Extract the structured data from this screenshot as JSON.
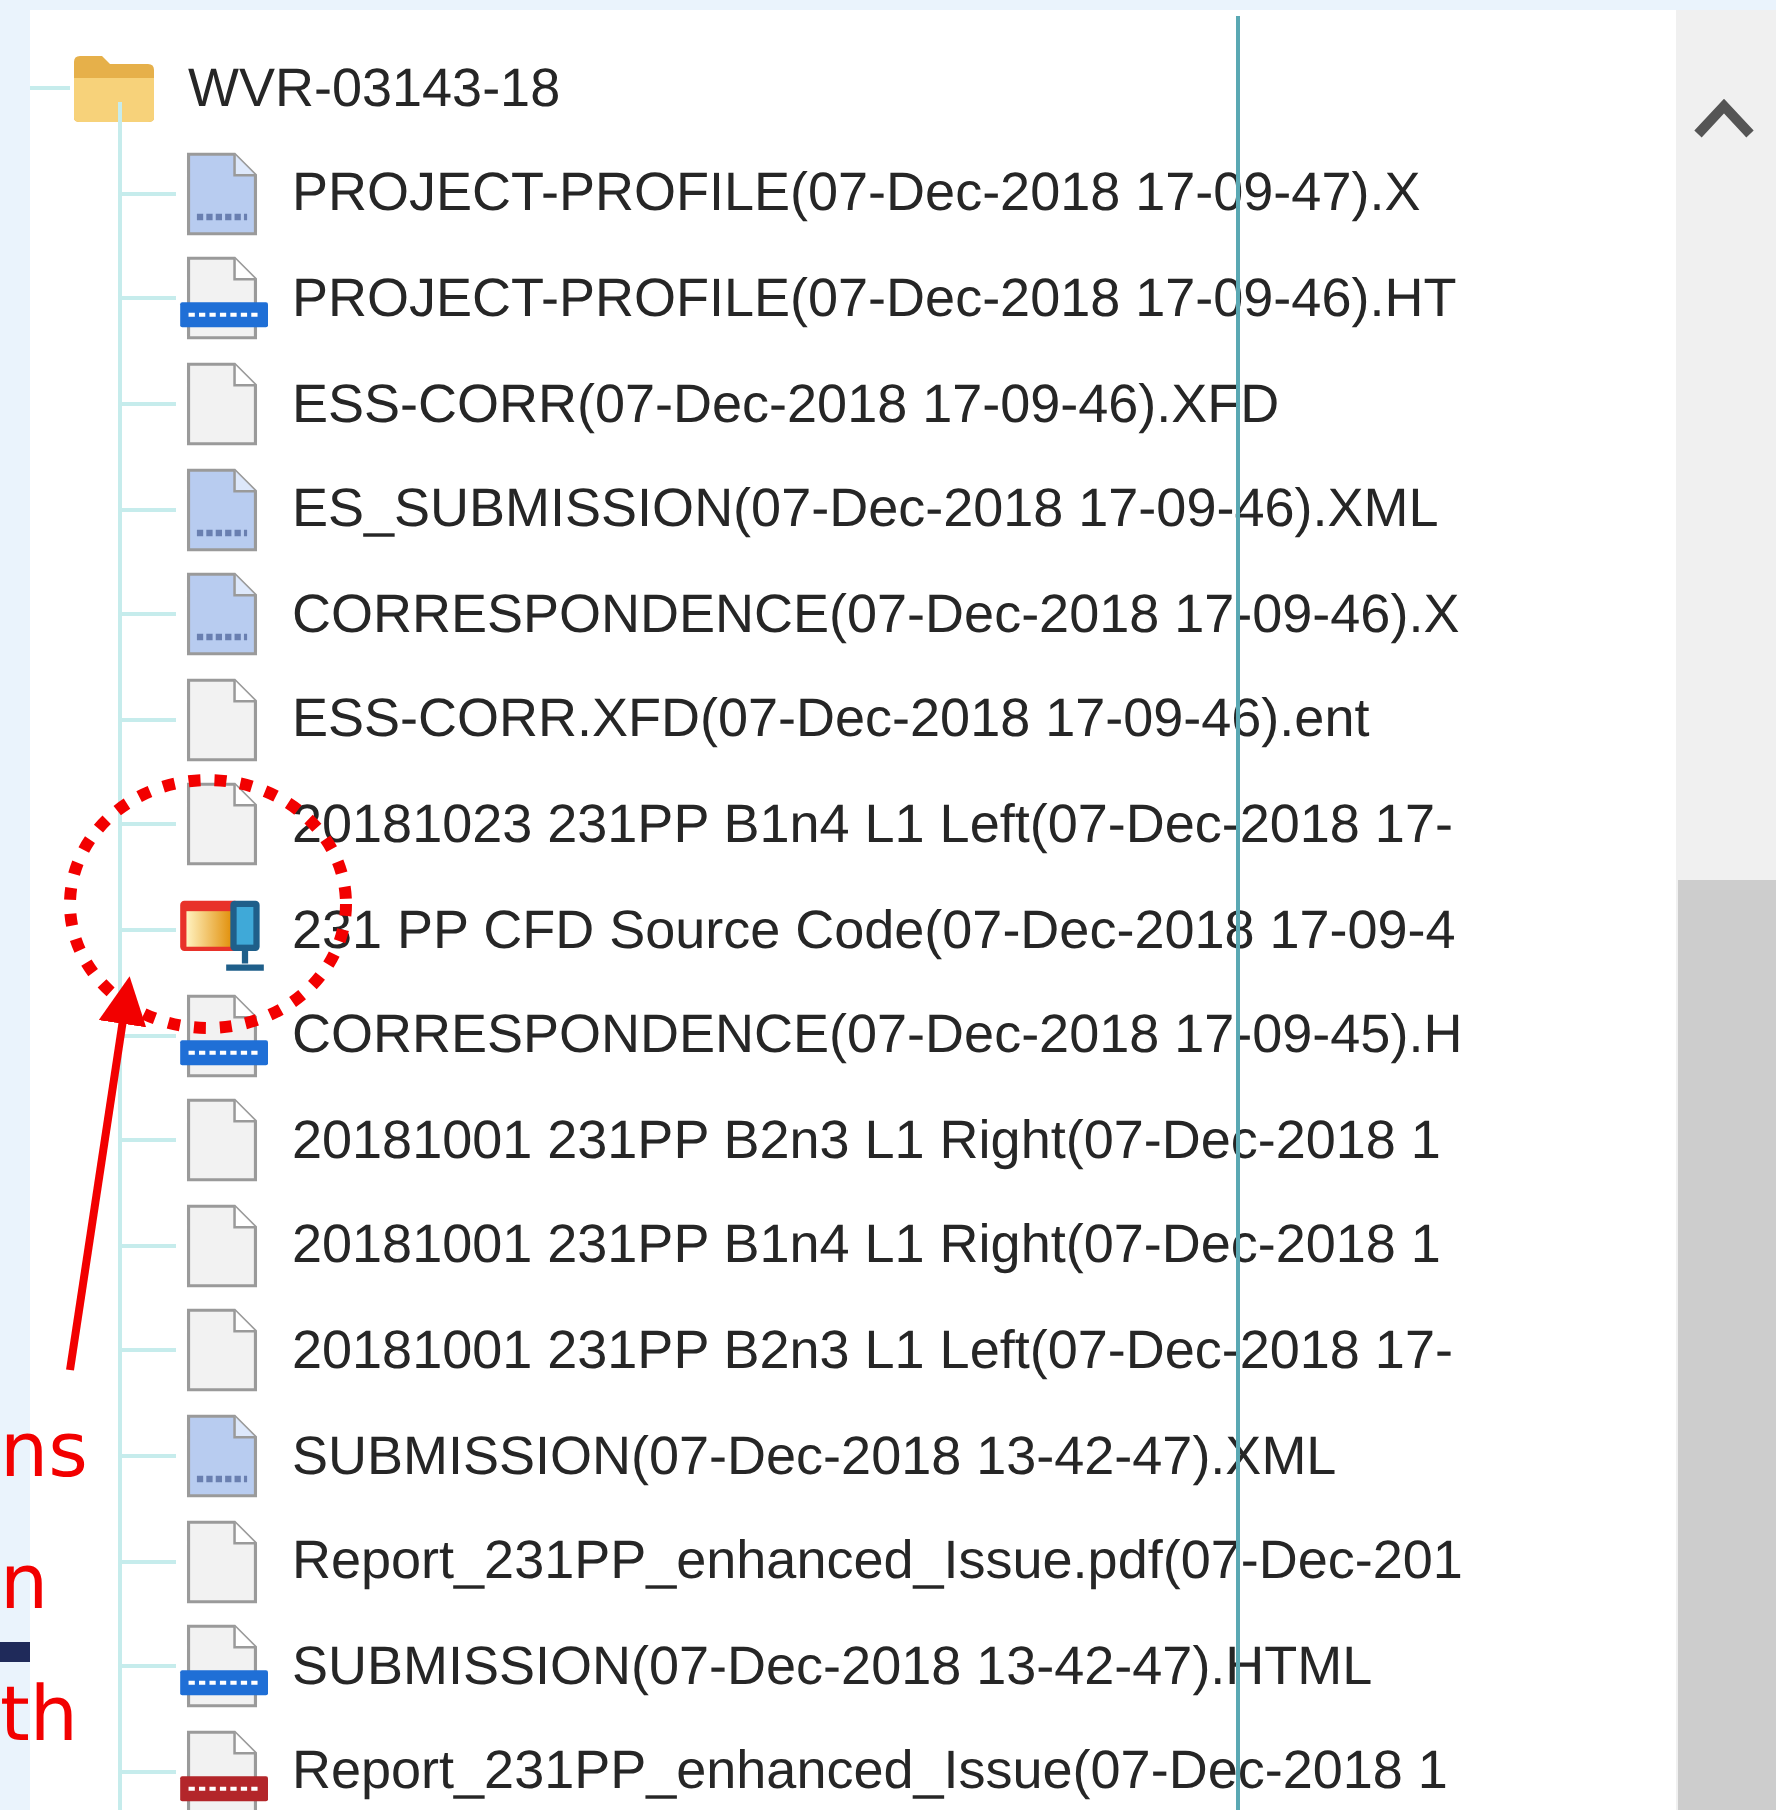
{
  "tree": {
    "folder": {
      "name": "WVR-03143-18",
      "children": [
        {
          "kind": "xml",
          "name": "PROJECT-PROFILE(07-Dec-2018 17-09-47).X"
        },
        {
          "kind": "html",
          "name": "PROJECT-PROFILE(07-Dec-2018 17-09-46).HT"
        },
        {
          "kind": "blank",
          "name": "ESS-CORR(07-Dec-2018 17-09-46).XFD"
        },
        {
          "kind": "xml",
          "name": "ES_SUBMISSION(07-Dec-2018 17-09-46).XML"
        },
        {
          "kind": "xml",
          "name": "CORRESPONDENCE(07-Dec-2018 17-09-46).X"
        },
        {
          "kind": "blank",
          "name": "ESS-CORR.XFD(07-Dec-2018 17-09-46).ent"
        },
        {
          "kind": "blank",
          "name": "20181023 231PP B1n4 L1 Left(07-Dec-2018 17-"
        },
        {
          "kind": "app",
          "name": "231 PP CFD Source Code(07-Dec-2018 17-09-4"
        },
        {
          "kind": "html",
          "name": "CORRESPONDENCE(07-Dec-2018 17-09-45).H"
        },
        {
          "kind": "blank",
          "name": "20181001 231PP B2n3 L1 Right(07-Dec-2018 1"
        },
        {
          "kind": "blank",
          "name": "20181001 231PP B1n4 L1 Right(07-Dec-2018 1"
        },
        {
          "kind": "blank",
          "name": "20181001 231PP B2n3 L1 Left(07-Dec-2018 17-"
        },
        {
          "kind": "xml",
          "name": "SUBMISSION(07-Dec-2018 13-42-47).XML"
        },
        {
          "kind": "blank",
          "name": "Report_231PP_enhanced_Issue.pdf(07-Dec-201"
        },
        {
          "kind": "html",
          "name": "SUBMISSION(07-Dec-2018 13-42-47).HTML"
        },
        {
          "kind": "pdf",
          "name": "Report_231PP_enhanced_Issue(07-Dec-2018 1"
        }
      ]
    }
  },
  "annotation": {
    "labels": [
      "ns",
      "n",
      "th"
    ]
  }
}
